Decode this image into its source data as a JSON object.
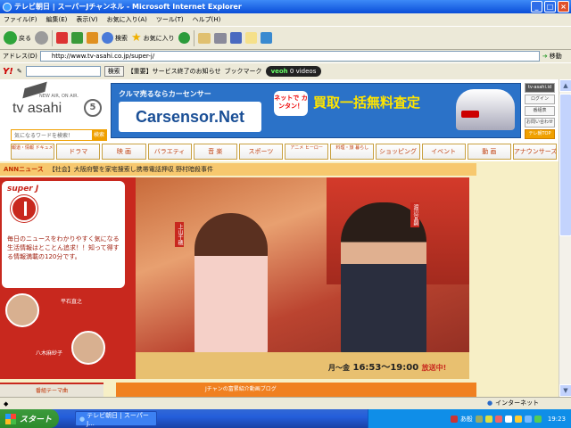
{
  "window": {
    "title": "テレビ朝日 | スーパーJチャンネル - Microsoft Internet Explorer",
    "min": "_",
    "max": "□",
    "close": "×"
  },
  "menu": [
    "ファイル(F)",
    "編集(E)",
    "表示(V)",
    "お気に入り(A)",
    "ツール(T)",
    "ヘルプ(H)"
  ],
  "toolbar": {
    "back": "戻る",
    "search": "検索",
    "favorites": "お気に入り"
  },
  "address": {
    "label": "アドレス(D)",
    "url": "http://www.tv-asahi.co.jp/super-j/",
    "go": "移動"
  },
  "ybar": {
    "logo": "Y!",
    "search_btn": "検索",
    "news": "【重要】サービス終了のお知らせ",
    "bookmark": "ブックマーク",
    "veoh": "veoh",
    "videos": "0 videos"
  },
  "header": {
    "tagline": "NEW AIR, ON AIR.",
    "logo": "tv asahi",
    "channel": "5",
    "search_placeholder": "気になるワードを検索！",
    "search_btn": "検索",
    "banner": {
      "tagline": "クルマ売るならカーセンサー",
      "brand": "Carsensor.Net",
      "bubble": "ネットで カンタン！",
      "headline": "買取一括無料査定"
    },
    "side": [
      "tv-asahi.id",
      "ログイン",
      "番組表",
      "お問い合わせ",
      "テレ朝TOP"
    ],
    "nav": [
      "報道・情報 ドキュメンタリー",
      "ドラマ",
      "映 画",
      "バラエティ",
      "音 楽",
      "スポーツ",
      "アニメ ヒーロー",
      "料理・旅 暮らし",
      "ショッピング",
      "イベント",
      "動 画",
      "アナウンサーズ"
    ]
  },
  "news": {
    "label": "ANNニュース",
    "headline": "【社会】大阪府警を家宅捜索し携帯電話押収  野村暗殺事件"
  },
  "program": {
    "logo": "super J",
    "desc": "毎日のニュースをわかりやすく気になる生活情報はとことん追求！！知って得する情報満載の120分です。",
    "casters": [
      "平石直之",
      "八木麻紗子"
    ],
    "anchors": [
      "上山千穂",
      "渡辺宜嗣"
    ],
    "schedule": "月～金",
    "time": "16:53～19:00",
    "onair": "放送中!"
  },
  "bottom": {
    "left": "番組テーマ曲",
    "right": "Jチャンの富累紹介動画ブログ"
  },
  "status": {
    "zone": "インターネット"
  },
  "taskbar": {
    "start": "スタート",
    "task": "テレビ朝日 | スーパーJ...",
    "ime": "あ般",
    "time": "19:23"
  }
}
